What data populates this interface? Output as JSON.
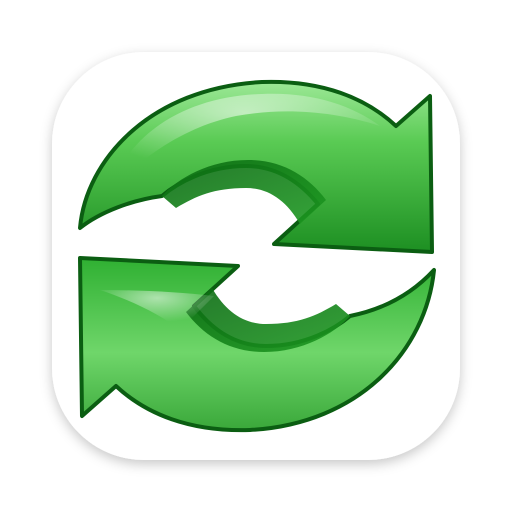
{
  "icon": {
    "name": "sync-arrows-icon",
    "colors": {
      "tile_background": "#ffffff",
      "arrow_light": "#7ee07a",
      "arrow_mid": "#3cb83a",
      "arrow_dark": "#0f7a16",
      "arrow_outline": "#0b5e12",
      "arrow_inner_shadow": "#0d6b12"
    }
  }
}
